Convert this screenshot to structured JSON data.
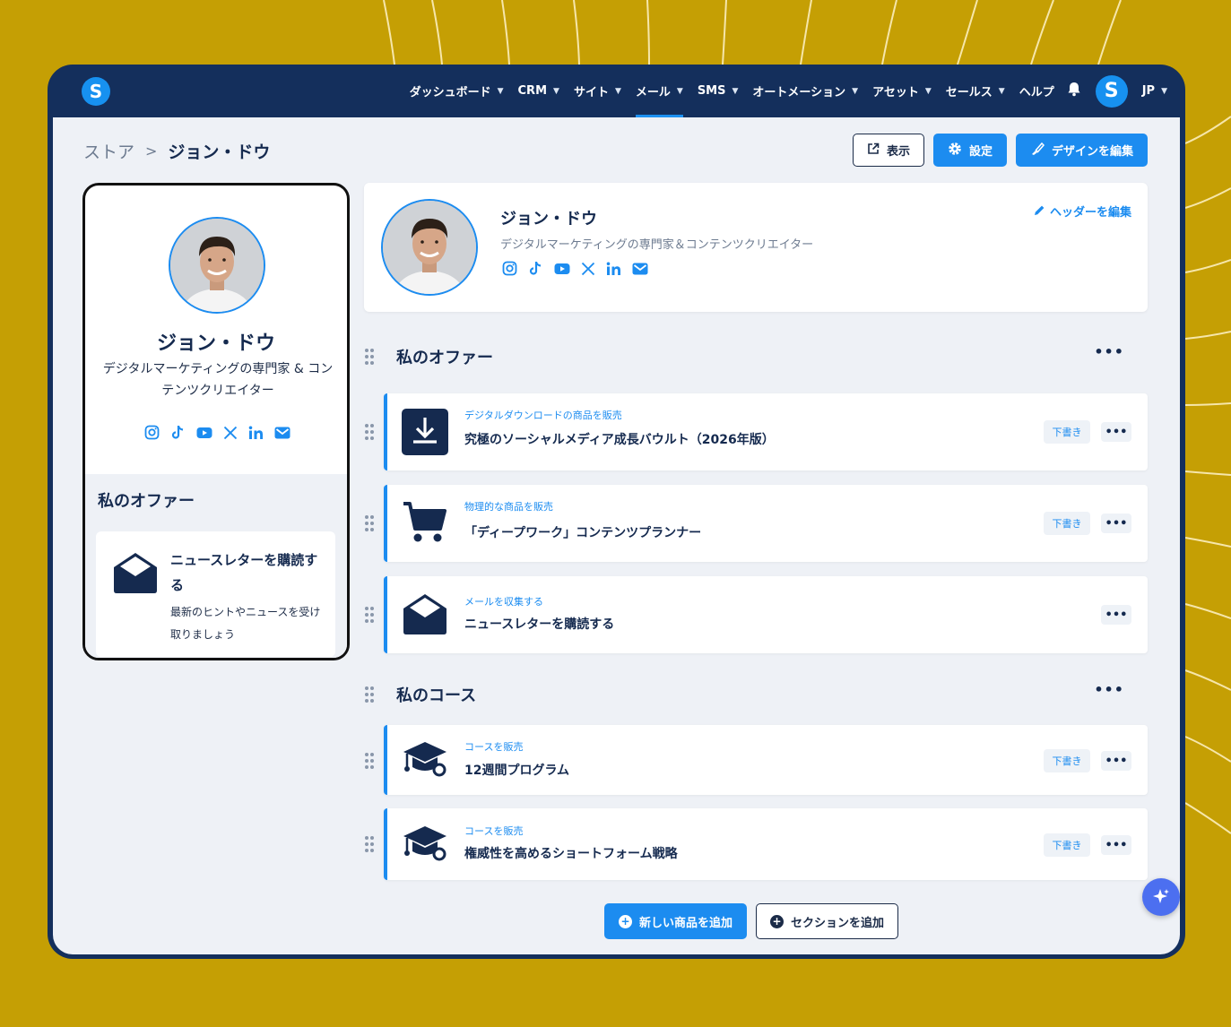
{
  "app": {
    "logo_letter": "S"
  },
  "nav": {
    "items": [
      {
        "label": "ダッシュボード",
        "chevron": true,
        "active": false
      },
      {
        "label": "CRM",
        "chevron": true,
        "active": false
      },
      {
        "label": "サイト",
        "chevron": true,
        "active": false
      },
      {
        "label": "メール",
        "chevron": true,
        "active": true
      },
      {
        "label": "SMS",
        "chevron": true,
        "active": false
      },
      {
        "label": "オートメーション",
        "chevron": true,
        "active": false
      },
      {
        "label": "アセット",
        "chevron": true,
        "active": false
      },
      {
        "label": "セールス",
        "chevron": true,
        "active": false
      },
      {
        "label": "ヘルプ",
        "chevron": false,
        "active": false
      }
    ],
    "avatar_letter": "S",
    "language": "JP"
  },
  "breadcrumb": {
    "root": "ストア",
    "current": "ジョン・ドウ"
  },
  "actions": {
    "view": "表示",
    "settings": "設定",
    "edit_design": "デザインを編集"
  },
  "profile": {
    "name": "ジョン・ドウ",
    "description": "デジタルマーケティングの専門家＆コンテンツクリエイター",
    "description_preview": "デジタルマーケティングの専門家 & コンテンツクリエイター",
    "social": [
      "instagram-icon",
      "tiktok-icon",
      "youtube-icon",
      "x-icon",
      "linkedin-icon",
      "mail-icon"
    ],
    "edit_header": "ヘッダーを編集"
  },
  "preview": {
    "offers_title": "私のオファー",
    "card_title": "ニュースレターを購読する",
    "card_desc": "最新のヒントやニュースを受け取りましょう"
  },
  "sections": {
    "offers": {
      "title": "私のオファー",
      "items": [
        {
          "label": "デジタルダウンロードの商品を販売",
          "title": "究極のソーシャルメディア成長バウルト（2026年版）",
          "icon": "download-icon",
          "draft": "下書き"
        },
        {
          "label": "物理的な商品を販売",
          "title": "「ディープワーク」コンテンツプランナー",
          "icon": "cart-icon",
          "draft": "下書き"
        },
        {
          "label": "メールを収集する",
          "title": "ニュースレターを購読する",
          "icon": "envelope-icon",
          "draft": ""
        }
      ]
    },
    "courses": {
      "title": "私のコース",
      "items": [
        {
          "label": "コースを販売",
          "title": "12週間プログラム",
          "icon": "graduation-cap-icon",
          "draft": "下書き"
        },
        {
          "label": "コースを販売",
          "title": "権威性を高めるショートフォーム戦略",
          "icon": "graduation-cap-icon",
          "draft": "下書き"
        }
      ]
    }
  },
  "bottom": {
    "add_product": "新しい商品を追加",
    "add_section": "セクションを追加"
  },
  "more_glyph": "•••",
  "colors": {
    "navy": "#142f5c",
    "accent": "#1c8cf0",
    "background": "#c59f04"
  }
}
